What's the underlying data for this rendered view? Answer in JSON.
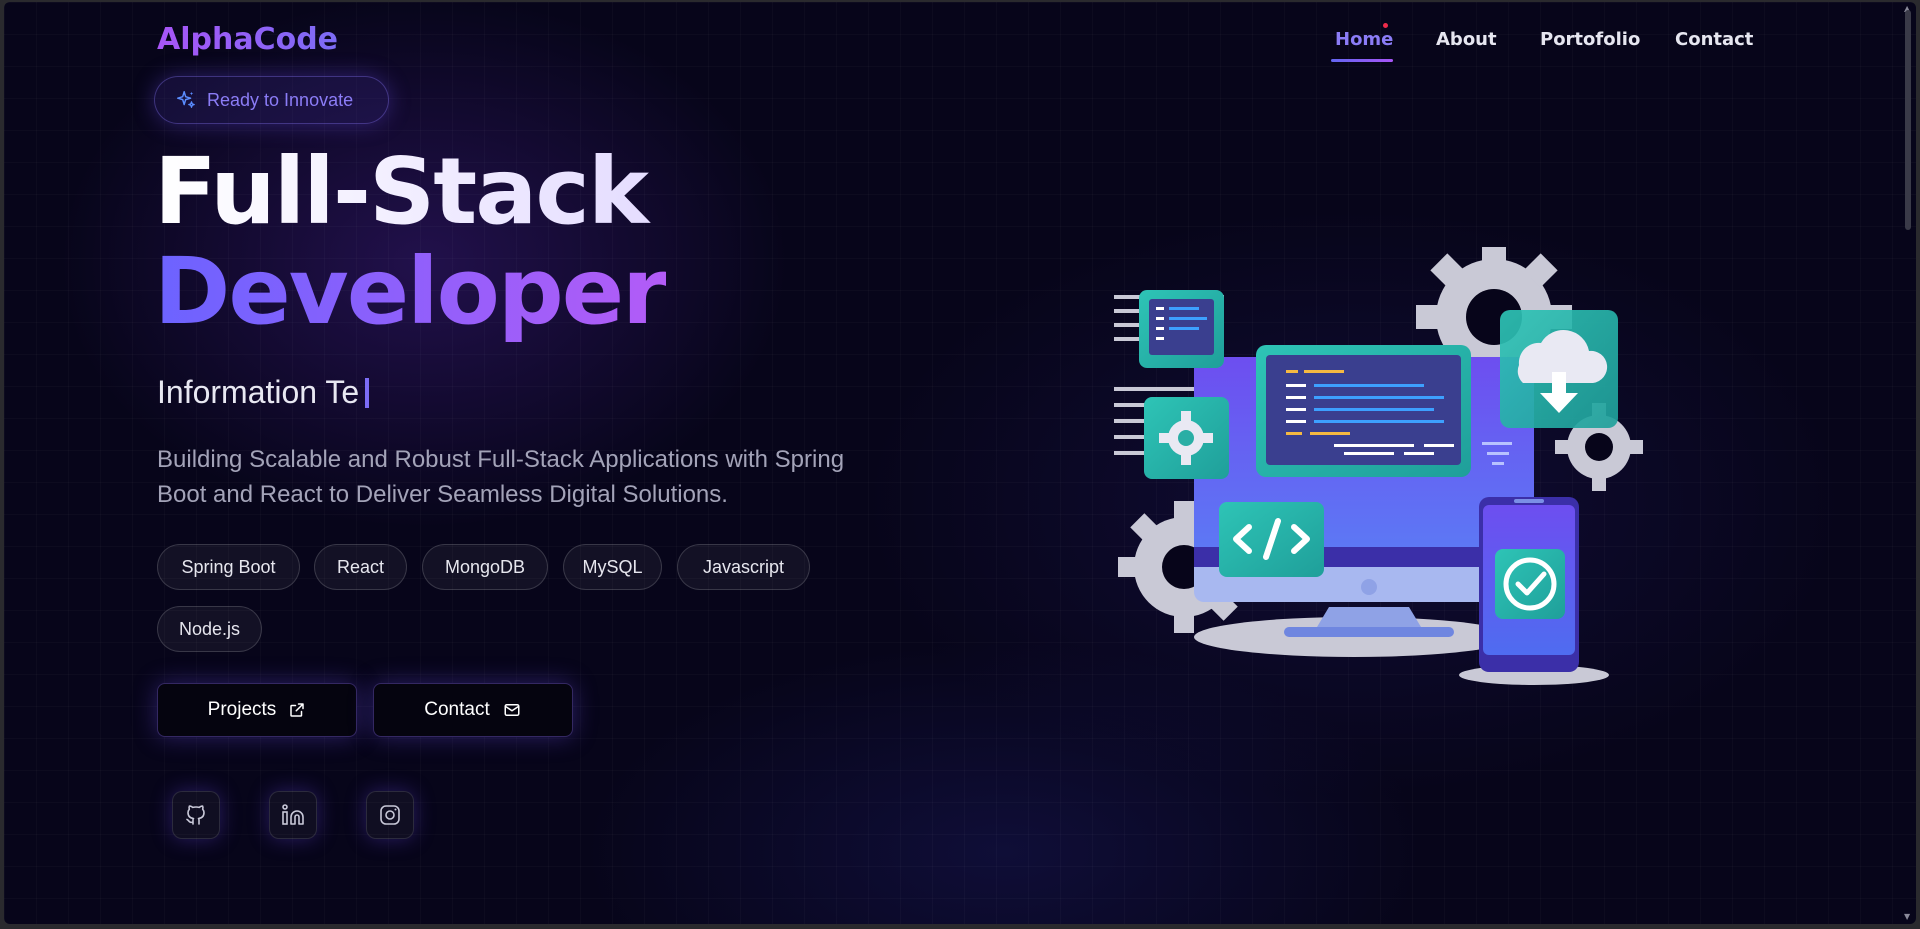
{
  "brand": {
    "logo": "AlphaCode"
  },
  "nav": {
    "items": [
      {
        "label": "Home",
        "active": true
      },
      {
        "label": "About",
        "active": false
      },
      {
        "label": "Portofolio",
        "active": false
      },
      {
        "label": "Contact",
        "active": false
      }
    ]
  },
  "hero": {
    "badge": "Ready to Innovate",
    "title_line1": "Full-Stack",
    "title_line2": "Developer",
    "typing_text": "Information Te",
    "description": "Building Scalable and Robust Full-Stack Applications with Spring Boot and React to Deliver Seamless Digital Solutions.",
    "tech": [
      "Spring Boot",
      "React",
      "MongoDB",
      "MySQL",
      "Javascript",
      "Node.js"
    ],
    "buttons": {
      "projects": "Projects",
      "contact": "Contact"
    },
    "social": [
      {
        "name": "github-icon"
      },
      {
        "name": "linkedin-icon"
      },
      {
        "name": "instagram-icon"
      }
    ]
  },
  "colors": {
    "background": "#07051a",
    "accent": "#7c6cf5",
    "accent_purple": "#a855f7",
    "text": "#e6e6f0",
    "muted": "#a3a3b8"
  }
}
